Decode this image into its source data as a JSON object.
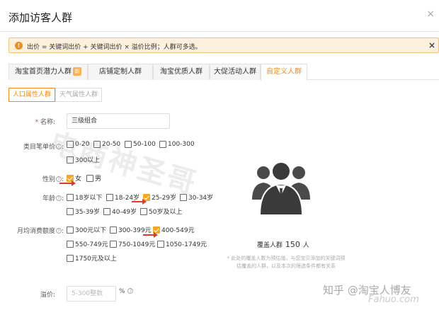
{
  "dialog": {
    "title": "添加访客人群",
    "close_icon": "close-icon"
  },
  "notice": {
    "icon_text": "!",
    "text": "出价 = 关键词出价 + 关键词出价 × 溢价比例；人群可多选。",
    "close_label": "×"
  },
  "tabs": [
    {
      "label": "淘宝首页潜力人群",
      "badge": "新"
    },
    {
      "label": "店铺定制人群"
    },
    {
      "label": "淘宝优质人群"
    },
    {
      "label": "大促活动人群"
    },
    {
      "label": "自定义人群",
      "active": true
    }
  ],
  "subtabs": [
    {
      "label": "人口属性人群",
      "active": true
    },
    {
      "label": "天气属性人群"
    }
  ],
  "form": {
    "name": {
      "required_mark": "*",
      "label": "名称:",
      "value": "三级组合"
    },
    "category_price": {
      "label": "类目笔单价",
      "options": [
        {
          "label": "0-20",
          "checked": false
        },
        {
          "label": "20-50",
          "checked": false
        },
        {
          "label": "50-100",
          "checked": false
        },
        {
          "label": "100-300",
          "checked": false
        },
        {
          "label": "300以上",
          "checked": false
        }
      ]
    },
    "gender": {
      "label": "性别",
      "options": [
        {
          "label": "女",
          "checked": true
        },
        {
          "label": "男",
          "checked": false
        }
      ]
    },
    "age": {
      "label": "年龄",
      "options": [
        {
          "label": "18岁以下",
          "checked": false
        },
        {
          "label": "18-24岁",
          "checked": false
        },
        {
          "label": "25-29岁",
          "checked": true
        },
        {
          "label": "30-34岁",
          "checked": false
        },
        {
          "label": "35-39岁",
          "checked": false
        },
        {
          "label": "40-49岁",
          "checked": false
        },
        {
          "label": "50岁及以上",
          "checked": false
        }
      ]
    },
    "monthly_spend": {
      "label": "月均消费额度",
      "options": [
        {
          "label": "300元以下",
          "checked": false
        },
        {
          "label": "300-399元",
          "checked": false
        },
        {
          "label": "400-549元",
          "checked": true
        },
        {
          "label": "550-749元",
          "checked": false
        },
        {
          "label": "750-1049元",
          "checked": false
        },
        {
          "label": "1050-1749元",
          "checked": false
        },
        {
          "label": "1750元及以上",
          "checked": false
        }
      ]
    },
    "premium": {
      "label": "溢价:",
      "placeholder": "5-300整数",
      "unit": "%"
    }
  },
  "coverage": {
    "prefix": "覆盖人群",
    "count": "150",
    "unit": "人",
    "note": "* 此处的覆盖人数为预估值，与您宝贝添加的关键词预估覆盖的人群，以及本次的筛选条件都有关系"
  },
  "watermarks": {
    "main": "电商神圣哥",
    "zhihu": "知乎 @淘宝人博友",
    "en": "Fahuo.com"
  },
  "colors": {
    "accent": "#f08c1a",
    "notice_bg": "#fdf0dc",
    "arrow": "#e03a2c",
    "checkbox_checked": "#f5a623"
  }
}
